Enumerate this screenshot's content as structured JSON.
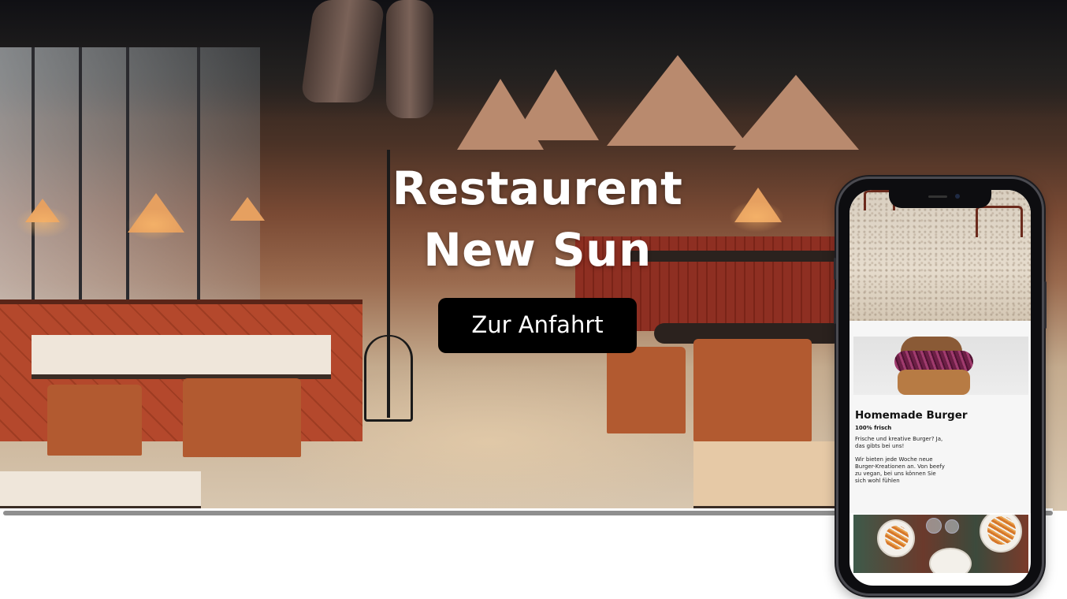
{
  "hero": {
    "title_line1": "Restaurent",
    "title_line2": "New Sun",
    "cta_label": "Zur Anfahrt"
  },
  "phone": {
    "card": {
      "title": "Homemade Burger",
      "subtitle": "100% frisch",
      "paragraph1_line1": "Frische und kreative Burger? Ja,",
      "paragraph1_line2": "das gibts bei uns!",
      "paragraph2_line1": "Wir bieten jede Woche neue",
      "paragraph2_line2": "Burger-Kreationen an. Von beefy",
      "paragraph2_line3": "zu vegan, bei uns können Sie",
      "paragraph2_line4": "sich wohl fühlen"
    }
  },
  "colors": {
    "cta_background": "#000000",
    "cta_text": "#ffffff",
    "title_text": "#ffffff"
  }
}
